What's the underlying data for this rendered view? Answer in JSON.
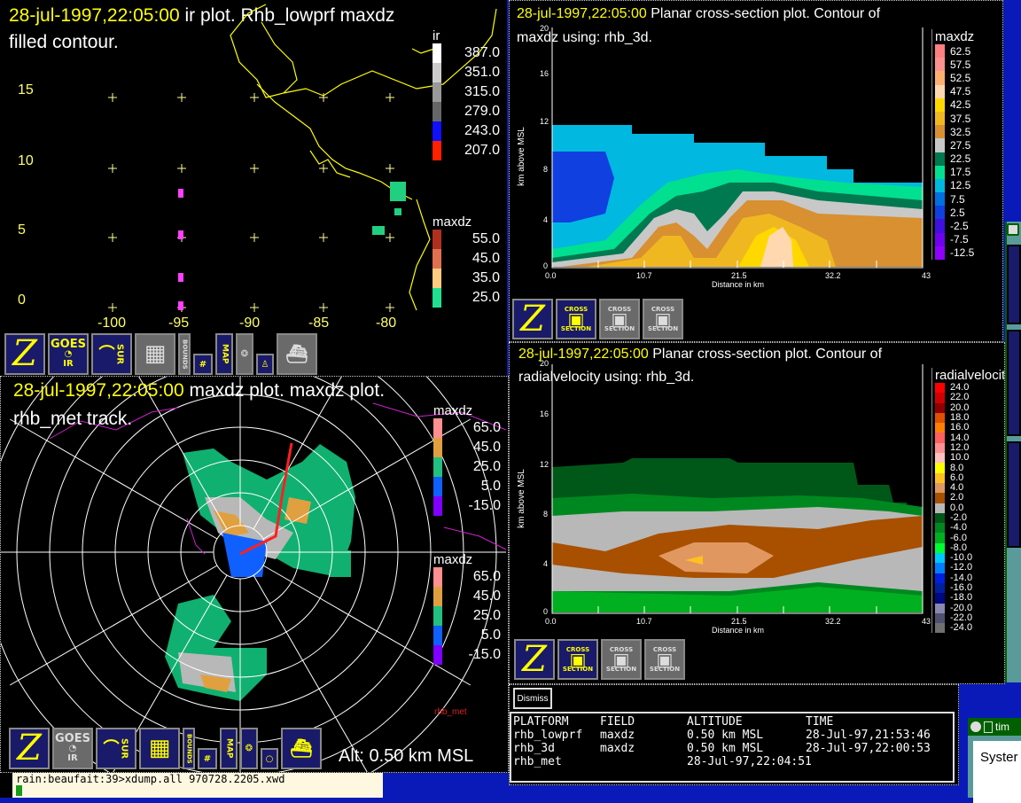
{
  "ir_panel": {
    "date": "28-jul-1997,22:05:00",
    "title": "  ir plot.  Rhb_lowprf maxdz",
    "title2": "filled contour.",
    "y_ticks": [
      "15",
      "10",
      "5",
      "0"
    ],
    "x_ticks": [
      "-100",
      "-95",
      "-90",
      "-85",
      "-80"
    ],
    "legend_ir": {
      "label": "ir",
      "items": [
        {
          "value": "387.0",
          "color": "#ffffff"
        },
        {
          "value": "351.0",
          "color": "#cccccc"
        },
        {
          "value": "315.0",
          "color": "#999999"
        },
        {
          "value": "279.0",
          "color": "#666666"
        },
        {
          "value": "243.0",
          "color": "#1010ff"
        },
        {
          "value": "207.0",
          "color": "#ff2000"
        }
      ]
    },
    "legend_maxdz": {
      "label": "maxdz",
      "items": [
        {
          "value": "55.0",
          "color": "#b03020"
        },
        {
          "value": "45.0",
          "color": "#e07050"
        },
        {
          "value": "35.0",
          "color": "#ffcc80"
        },
        {
          "value": "25.0",
          "color": "#20e090"
        }
      ]
    }
  },
  "toolbar_top": {
    "goes": "GOES",
    "ir": "IR",
    "sur": "SUR",
    "bounds": "BOUNDS",
    "map": "MAP"
  },
  "radar_panel": {
    "date": "28-jul-1997,22:05:00",
    "title": "  maxdz plot.  maxdz plot.",
    "title2": "rhb_met track.",
    "legend1": {
      "label": "maxdz",
      "items": [
        {
          "value": "65.0",
          "color": "#ff9090"
        },
        {
          "value": "45.0",
          "color": "#e0a040"
        },
        {
          "value": "25.0",
          "color": "#20c080"
        },
        {
          "value": "5.0",
          "color": "#1060ff"
        },
        {
          "value": "-15.0",
          "color": "#8000ff"
        }
      ]
    },
    "legend2": {
      "label": "maxdz",
      "items": [
        {
          "value": "65.0",
          "color": "#ff9090"
        },
        {
          "value": "45.0",
          "color": "#e0a040"
        },
        {
          "value": "25.0",
          "color": "#20c080"
        },
        {
          "value": "5.0",
          "color": "#1060ff"
        },
        {
          "value": "-15.0",
          "color": "#8000ff"
        }
      ]
    },
    "track_label": "rhb_met",
    "altitude": "Alt: 0.50 km MSL"
  },
  "toolbar_bottom": {
    "goes": "GOES",
    "ir": "IR",
    "sur": "SUR",
    "bounds": "BOUNDS",
    "map": "MAP"
  },
  "xsec_maxdz": {
    "date": "28-jul-1997,22:05:00",
    "title": "  Planar cross-section plot.  Contour of",
    "title2": "maxdz using: rhb_3d.",
    "ylabel": "km above MSL",
    "xlabel": "Distance in km",
    "y_ticks": [
      "20",
      "16",
      "12",
      "8",
      "4",
      "0"
    ],
    "x_ticks": [
      "0.0",
      "10.7",
      "21.5",
      "32.2",
      "43"
    ],
    "legend": {
      "label": "maxdz",
      "items": [
        {
          "value": "62.5",
          "color": "#ff8080"
        },
        {
          "value": "57.5",
          "color": "#ff9090"
        },
        {
          "value": "52.5",
          "color": "#ffb070"
        },
        {
          "value": "47.5",
          "color": "#ffd8b0"
        },
        {
          "value": "42.5",
          "color": "#ffd800"
        },
        {
          "value": "37.5",
          "color": "#f0b820"
        },
        {
          "value": "32.5",
          "color": "#d89030"
        },
        {
          "value": "27.5",
          "color": "#c8c8c8"
        },
        {
          "value": "22.5",
          "color": "#007850"
        },
        {
          "value": "17.5",
          "color": "#00e090"
        },
        {
          "value": "12.5",
          "color": "#00b8e0"
        },
        {
          "value": "7.5",
          "color": "#0070e0"
        },
        {
          "value": "2.5",
          "color": "#1040e0"
        },
        {
          "value": "-2.5",
          "color": "#4010e0"
        },
        {
          "value": "-7.5",
          "color": "#7000f0"
        },
        {
          "value": "-12.5",
          "color": "#9000ff"
        }
      ]
    }
  },
  "xsec_toolbar": {
    "cross": "CROSS",
    "section": "SECTION"
  },
  "xsec_vel": {
    "date": "28-jul-1997,22:05:00",
    "title": "  Planar cross-section plot.  Contour of",
    "title2": "radialvelocity using: rhb_3d.",
    "ylabel": "km above MSL",
    "xlabel": "Distance in km",
    "y_ticks": [
      "20",
      "16",
      "12",
      "8",
      "4",
      "0"
    ],
    "x_ticks": [
      "0.0",
      "10.7",
      "21.5",
      "32.2",
      "43"
    ],
    "legend": {
      "label": "radialvelocity",
      "items": [
        {
          "value": "24.0",
          "color": "#ff0000"
        },
        {
          "value": "22.0",
          "color": "#d00000"
        },
        {
          "value": "20.0",
          "color": "#900000"
        },
        {
          "value": "18.0",
          "color": "#e05000"
        },
        {
          "value": "16.0",
          "color": "#ff8000"
        },
        {
          "value": "14.0",
          "color": "#ff6060"
        },
        {
          "value": "12.0",
          "color": "#ff9090"
        },
        {
          "value": "10.0",
          "color": "#ffc0c0"
        },
        {
          "value": "8.0",
          "color": "#ffff00"
        },
        {
          "value": "6.0",
          "color": "#ffc020"
        },
        {
          "value": "4.0",
          "color": "#e09860"
        },
        {
          "value": "2.0",
          "color": "#a85000"
        },
        {
          "value": "0.0",
          "color": "#b8b8b8"
        },
        {
          "value": "-2.0",
          "color": "#005818"
        },
        {
          "value": "-4.0",
          "color": "#008820"
        },
        {
          "value": "-6.0",
          "color": "#00b020"
        },
        {
          "value": "-8.0",
          "color": "#00ff30"
        },
        {
          "value": "-10.0",
          "color": "#00c8ff"
        },
        {
          "value": "-12.0",
          "color": "#0080ff"
        },
        {
          "value": "-14.0",
          "color": "#0020e0"
        },
        {
          "value": "-16.0",
          "color": "#0020a0"
        },
        {
          "value": "-18.0",
          "color": "#000880"
        },
        {
          "value": "-20.0",
          "color": "#8888b0"
        },
        {
          "value": "-22.0",
          "color": "#505070"
        },
        {
          "value": "-24.0",
          "color": "#707070"
        }
      ]
    }
  },
  "dismiss_label": "Dismiss",
  "platform_table": {
    "headers": [
      "PLATFORM",
      "FIELD",
      "ALTITUDE",
      "TIME"
    ],
    "rows": [
      [
        "rhb_lowprf",
        "maxdz",
        "0.50 km MSL",
        "28-Jul-97,21:53:46"
      ],
      [
        "rhb_3d",
        "maxdz",
        "0.50 km MSL",
        "28-Jul-97,22:00:53"
      ],
      [
        "rhb_met",
        "",
        "28-Jul-97,22:04:51",
        ""
      ]
    ]
  },
  "xterm_line": "rain:beaufait:39>xdump.all 970728.2205.xwd",
  "side_window": {
    "title": "tim",
    "content": "Syster"
  }
}
